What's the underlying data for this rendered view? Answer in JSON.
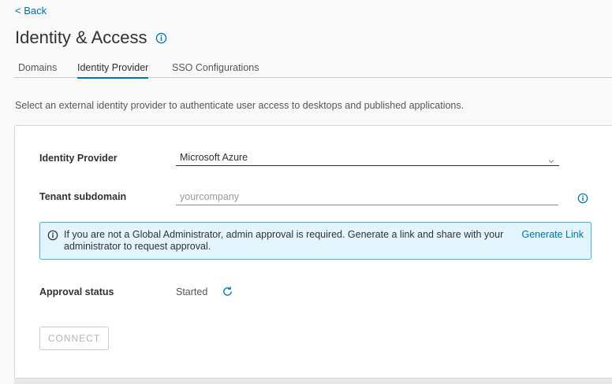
{
  "header": {
    "back_label": "< Back",
    "title": "Identity & Access"
  },
  "tabs": [
    {
      "label": "Domains",
      "active": false
    },
    {
      "label": "Identity Provider",
      "active": true
    },
    {
      "label": "SSO Configurations",
      "active": false
    }
  ],
  "description": "Select an external identity provider to authenticate user access to desktops and published applications.",
  "form": {
    "identity_provider": {
      "label": "Identity Provider",
      "value": "Microsoft Azure"
    },
    "tenant_subdomain": {
      "label": "Tenant subdomain",
      "value": "",
      "placeholder": "yourcompany"
    },
    "alert": {
      "text": "If you are not a Global Administrator, admin approval is required. Generate a link and share with your administrator to request approval.",
      "link_label": "Generate Link"
    },
    "approval_status": {
      "label": "Approval status",
      "value": "Started"
    },
    "connect_label": "CONNECT"
  },
  "icons": {
    "title_info": "info-circle-icon",
    "field_info": "info-circle-icon",
    "alert_info": "info-circle-icon",
    "refresh": "refresh-icon",
    "select_chevron": "chevron-down-icon"
  },
  "colors": {
    "accent": "#0072a3",
    "alert_background": "#e3f5fc",
    "alert_border": "#49afd9",
    "page_background": "#f9f9f9"
  }
}
